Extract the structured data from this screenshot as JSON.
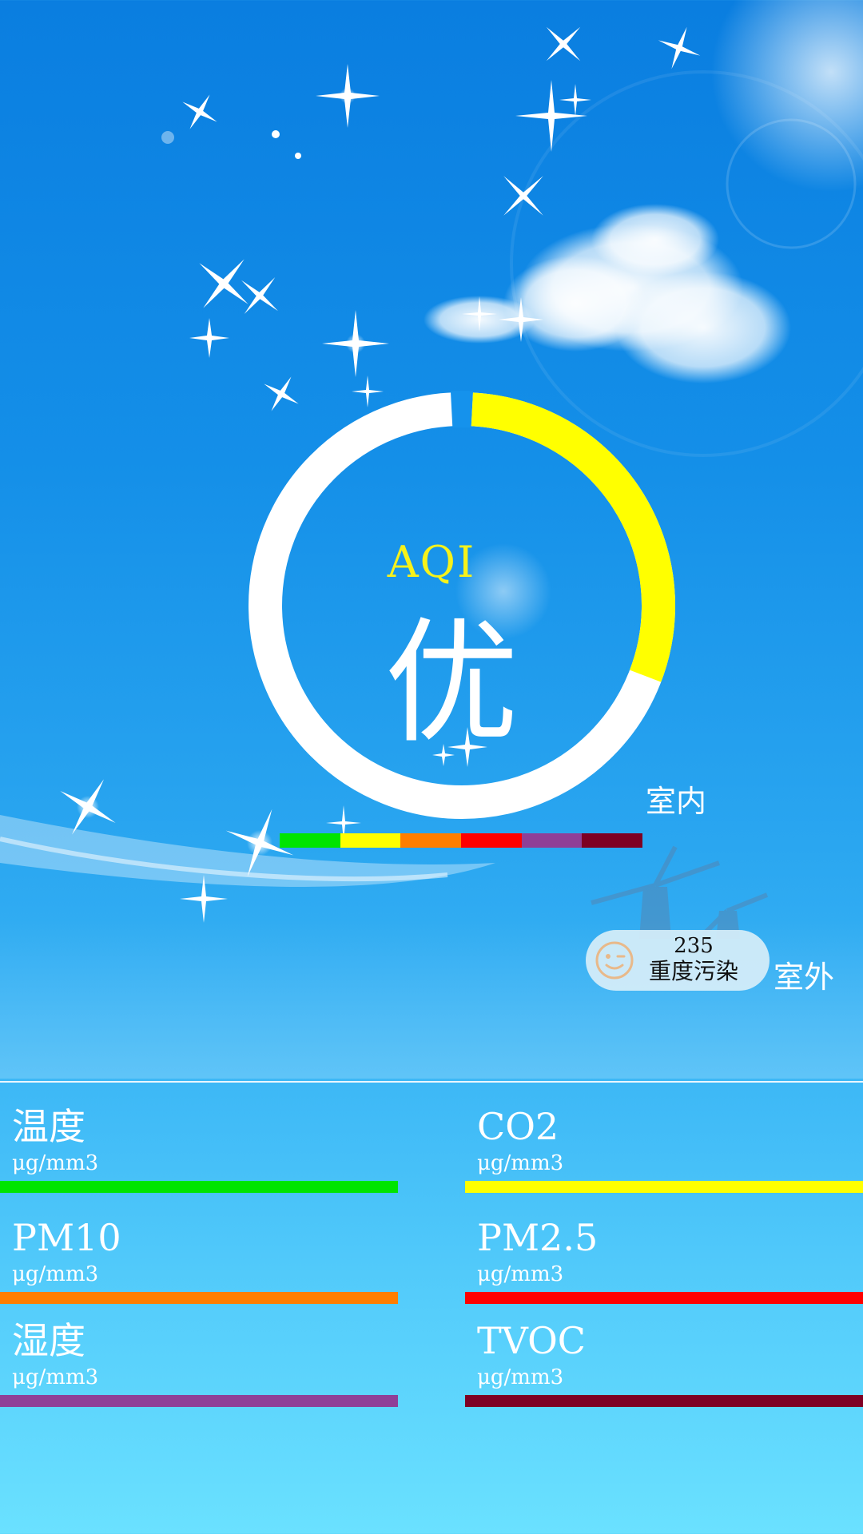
{
  "aqi": {
    "label": "AQI",
    "level": "优",
    "indoor_label": "室内",
    "progress": 0.3,
    "progress_color": "#ffff00",
    "ring_color": "#ffffff"
  },
  "scale_colors": [
    "#00e400",
    "#ffff00",
    "#ff7e00",
    "#ff0000",
    "#8f3f97",
    "#7e0023"
  ],
  "outdoor": {
    "value": "235",
    "status": "重度污染",
    "label": "室外",
    "icon": "smiley-wink-icon"
  },
  "metrics": [
    {
      "name": "温度",
      "unit": "μg/mm3",
      "color": "#00e400"
    },
    {
      "name": "CO2",
      "unit": "μg/mm3",
      "color": "#ffff00"
    },
    {
      "name": "PM10",
      "unit": "μg/mm3",
      "color": "#ff7e00"
    },
    {
      "name": "PM2.5",
      "unit": "μg/mm3",
      "color": "#ff0000"
    },
    {
      "name": "湿度",
      "unit": "μg/mm3",
      "color": "#8f3f97"
    },
    {
      "name": "TVOC",
      "unit": "μg/mm3",
      "color": "#7e0023"
    }
  ]
}
